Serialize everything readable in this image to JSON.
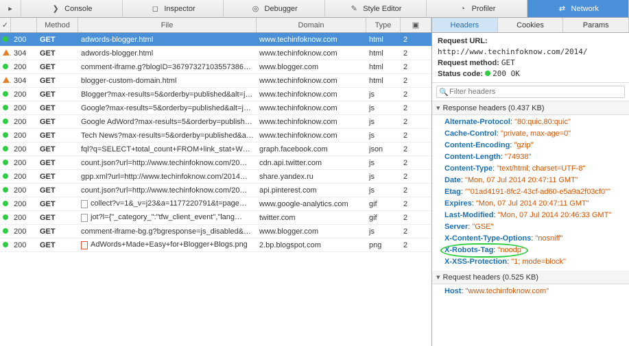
{
  "toolbar": {
    "console": "Console",
    "inspector": "Inspector",
    "debugger": "Debugger",
    "style_editor": "Style Editor",
    "profiler": "Profiler",
    "network": "Network"
  },
  "grid": {
    "head": {
      "method": "Method",
      "file": "File",
      "domain": "Domain",
      "type": "Type"
    },
    "rows": [
      {
        "st": "g",
        "code": "200",
        "m": "GET",
        "f": "adwords-blogger.html",
        "d": "www.techinfoknow.com",
        "t": "html",
        "sel": true
      },
      {
        "st": "o",
        "code": "304",
        "m": "GET",
        "f": "adwords-blogger.html",
        "d": "www.techinfoknow.com",
        "t": "html"
      },
      {
        "st": "g",
        "code": "200",
        "m": "GET",
        "f": "comment-iframe.g?blogID=367973271035573867…",
        "d": "www.blogger.com",
        "t": "html"
      },
      {
        "st": "o",
        "code": "304",
        "m": "GET",
        "f": "blogger-custom-domain.html",
        "d": "www.techinfoknow.com",
        "t": "html"
      },
      {
        "st": "g",
        "code": "200",
        "m": "GET",
        "f": "Blogger?max-results=5&orderby=published&alt=j…",
        "d": "www.techinfoknow.com",
        "t": "js"
      },
      {
        "st": "g",
        "code": "200",
        "m": "GET",
        "f": "Google?max-results=5&orderby=published&alt=j…",
        "d": "www.techinfoknow.com",
        "t": "js"
      },
      {
        "st": "g",
        "code": "200",
        "m": "GET",
        "f": "Google AdWord?max-results=5&orderby=publish…",
        "d": "www.techinfoknow.com",
        "t": "js"
      },
      {
        "st": "g",
        "code": "200",
        "m": "GET",
        "f": "Tech News?max-results=5&orderby=published&alt…",
        "d": "www.techinfoknow.com",
        "t": "js"
      },
      {
        "st": "g",
        "code": "200",
        "m": "GET",
        "f": "fql?q=SELECT+total_count+FROM+link_stat+WH…",
        "d": "graph.facebook.com",
        "t": "json"
      },
      {
        "st": "g",
        "code": "200",
        "m": "GET",
        "f": "count.json?url=http://www.techinfoknow.com/20…",
        "d": "cdn.api.twitter.com",
        "t": "js"
      },
      {
        "st": "g",
        "code": "200",
        "m": "GET",
        "f": "gpp.xml?url=http://www.techinfoknow.com/2014…",
        "d": "share.yandex.ru",
        "t": "js"
      },
      {
        "st": "g",
        "code": "200",
        "m": "GET",
        "f": "count.json?url=http://www.techinfoknow.com/20…",
        "d": "api.pinterest.com",
        "t": "js"
      },
      {
        "st": "g",
        "code": "200",
        "m": "GET",
        "f": "collect?v=1&_v=j23&a=1177220791&t=page…",
        "d": "www.google-analytics.com",
        "t": "gif",
        "fi": true
      },
      {
        "st": "g",
        "code": "200",
        "m": "GET",
        "f": "jot?l={\"_category_\":\"tfw_client_event\",\"lang…",
        "d": "twitter.com",
        "t": "gif",
        "fi": true
      },
      {
        "st": "g",
        "code": "200",
        "m": "GET",
        "f": "comment-iframe-bg.g?bgresponse=js_disabled&b…",
        "d": "www.blogger.com",
        "t": "js"
      },
      {
        "st": "g",
        "code": "200",
        "m": "GET",
        "f": "AdWords+Made+Easy+for+Blogger+Blogs.png",
        "d": "2.bp.blogspot.com",
        "t": "png",
        "fi": true,
        "img": true
      }
    ]
  },
  "details": {
    "tabs": {
      "headers": "Headers",
      "cookies": "Cookies",
      "params": "Params"
    },
    "req_url_lbl": "Request URL:",
    "req_url": "http://www.techinfoknow.com/2014/",
    "req_method_lbl": "Request method:",
    "req_method": "GET",
    "status_lbl": "Status code:",
    "status_val": "200 OK",
    "filter_placeholder": "Filter headers",
    "resp_head": "Response headers (0.437 KB)",
    "resp": [
      {
        "k": "Alternate-Protocol",
        "v": "80:quic,80:quic"
      },
      {
        "k": "Cache-Control",
        "v": "private, max-age=0"
      },
      {
        "k": "Content-Encoding",
        "v": "gzip"
      },
      {
        "k": "Content-Length",
        "v": "74938"
      },
      {
        "k": "Content-Type",
        "v": "text/html; charset=UTF-8"
      },
      {
        "k": "Date",
        "v": "Mon, 07 Jul 2014 20:47:11 GMT"
      },
      {
        "k": "Etag",
        "v": "\"01ad4191-8fc2-43cf-ad60-e5a9a2f03cf0\""
      },
      {
        "k": "Expires",
        "v": "Mon, 07 Jul 2014 20:47:11 GMT"
      },
      {
        "k": "Last-Modified",
        "v": "Mon, 07 Jul 2014 20:46:33 GMT"
      },
      {
        "k": "Server",
        "v": "GSE"
      },
      {
        "k": "X-Content-Type-Options",
        "v": "nosniff"
      },
      {
        "k": "X-Robots-Tag",
        "v": "noodp",
        "circ": true
      },
      {
        "k": "X-XSS-Protection",
        "v": "1; mode=block"
      }
    ],
    "reqh_head": "Request headers (0.525 KB)",
    "reqh": [
      {
        "k": "Host",
        "v": "www.techinfoknow.com"
      }
    ]
  }
}
